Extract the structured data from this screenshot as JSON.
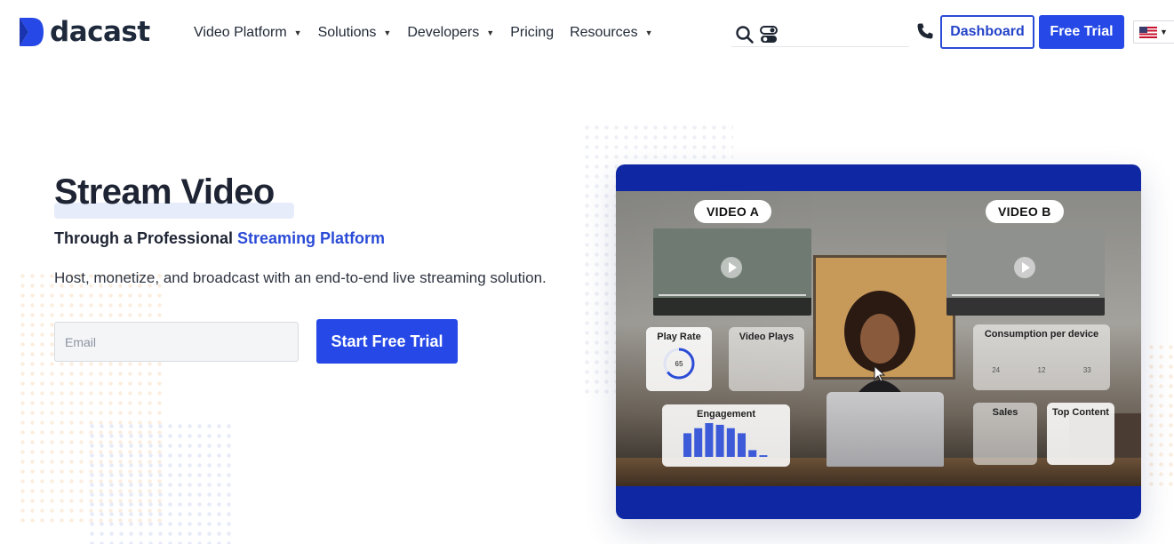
{
  "brand": {
    "name": "dacast",
    "primary_color": "#2548e6",
    "dark_color": "#1e2433"
  },
  "nav": {
    "menu": [
      {
        "label": "Video Platform",
        "has_dropdown": true
      },
      {
        "label": "Solutions",
        "has_dropdown": true
      },
      {
        "label": "Developers",
        "has_dropdown": true
      },
      {
        "label": "Pricing",
        "has_dropdown": false
      },
      {
        "label": "Resources",
        "has_dropdown": true
      }
    ],
    "icons": [
      "search-icon",
      "toggle-icon",
      "phone-icon"
    ],
    "dashboard_label": "Dashboard",
    "free_trial_label": "Free Trial",
    "language": {
      "selected": "United States flag",
      "icon": "us-flag-icon"
    }
  },
  "hero": {
    "title": "Stream Video",
    "subtitle_prefix": "Through a Professional ",
    "subtitle_accent": "Streaming Platform",
    "description": "Host, monetize, and broadcast with an end-to-end live streaming solution.",
    "email_placeholder": "Email",
    "cta_label": "Start Free Trial"
  },
  "video_card": {
    "label_a": "VIDEO A",
    "label_b": "VIDEO B",
    "play_rate_label": "Play Rate",
    "play_rate_value": "65",
    "play_rate_unit": "%",
    "video_plays_label": "Video Plays",
    "consumption_label": "Consumption per device",
    "consumption_values": [
      "24",
      "12",
      "33"
    ],
    "engagement_label": "Engagement",
    "engagement_bars": [
      28,
      34,
      40,
      38,
      34,
      28,
      8,
      2
    ],
    "sales_label": "Sales",
    "top_content_label": "Top Content"
  }
}
